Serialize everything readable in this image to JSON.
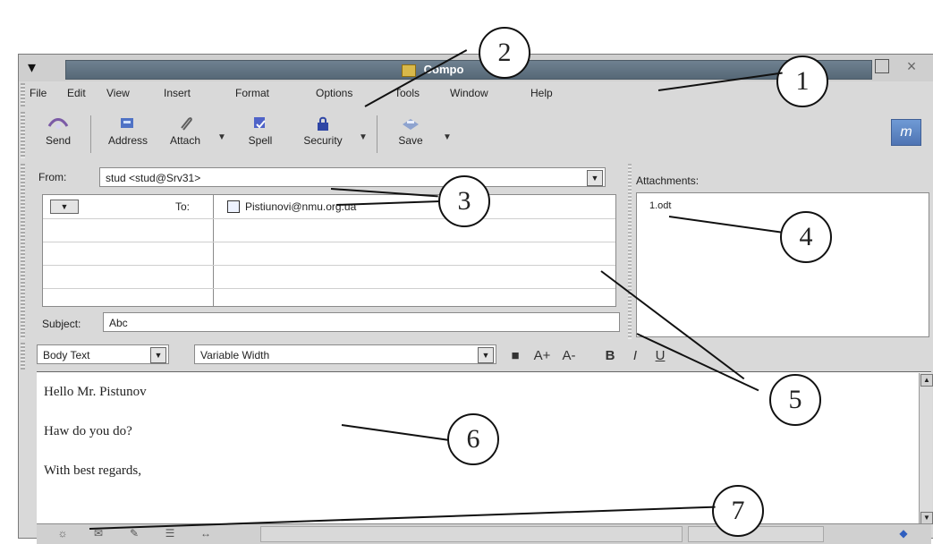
{
  "window": {
    "title": "Compo"
  },
  "menubar": {
    "items": [
      "File",
      "Edit",
      "View",
      "Insert",
      "Format",
      "Options",
      "Tools",
      "Window",
      "Help"
    ]
  },
  "toolbar": {
    "buttons": [
      "Send",
      "Address",
      "Attach",
      "Spell",
      "Security",
      "Save"
    ]
  },
  "compose": {
    "from_label": "From:",
    "from_value": "stud <stud@Srv31>",
    "to_label": "To:",
    "to_value": "Pistiunovi@nmu.org.ua",
    "subject_label": "Subject:",
    "subject_value": "Abc"
  },
  "attachments": {
    "label": "Attachments:",
    "items": [
      "1.odt"
    ]
  },
  "format": {
    "paragraph_style": "Body Text",
    "font": "Variable Width",
    "bold": "B",
    "italic": "I",
    "underline": "U",
    "size_up": "A+",
    "size_down": "A-"
  },
  "body": {
    "lines": [
      "Hello Mr. Pistunov",
      "Haw do you do?",
      "With best regards,"
    ]
  },
  "callouts": [
    "1",
    "2",
    "3",
    "4",
    "5",
    "6",
    "7"
  ]
}
